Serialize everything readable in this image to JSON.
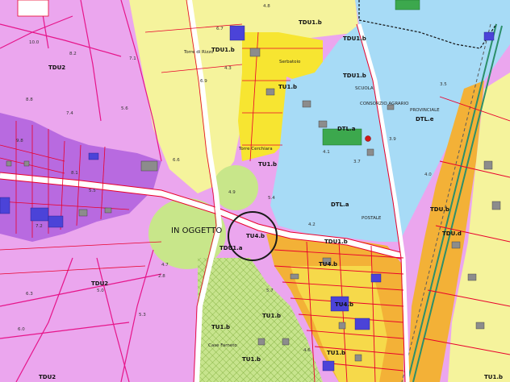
{
  "map": {
    "subject_label": "IN OGGETTO",
    "zone_labels": [
      {
        "key": "tdu2_a",
        "text": "TDU2"
      },
      {
        "key": "tdu2_b",
        "text": "TDU2"
      },
      {
        "key": "tdu2_c",
        "text": "TDU2"
      },
      {
        "key": "tdu1b_a",
        "text": "TDU1.b"
      },
      {
        "key": "tdu1b_b",
        "text": "TDU1.b"
      },
      {
        "key": "tdu1b_c",
        "text": "TDU1.b"
      },
      {
        "key": "tdu1b_d",
        "text": "TDU1.b"
      },
      {
        "key": "tdu1b_e",
        "text": "TDU1.b"
      },
      {
        "key": "tdu1a",
        "text": "TDU1.a"
      },
      {
        "key": "tu1b_a",
        "text": "TU1.b"
      },
      {
        "key": "tu1b_b",
        "text": "TU1.b"
      },
      {
        "key": "tu1b_c",
        "text": "TU1.b"
      },
      {
        "key": "tu1b_d",
        "text": "TU1.b"
      },
      {
        "key": "tu1b_e",
        "text": "TU1.b"
      },
      {
        "key": "tu1b_f",
        "text": "TU1.b"
      },
      {
        "key": "tu1b_g",
        "text": "TU1.b"
      },
      {
        "key": "tu4b_a",
        "text": "TU4.b"
      },
      {
        "key": "tu4b_b",
        "text": "TU4.b"
      },
      {
        "key": "tu4b_c",
        "text": "TU4.b"
      },
      {
        "key": "dtla_a",
        "text": "DTL.a"
      },
      {
        "key": "dtla_b",
        "text": "DTL.a"
      },
      {
        "key": "dtle",
        "text": "DTL.e"
      },
      {
        "key": "tdub",
        "text": "TDU.b"
      },
      {
        "key": "tdud",
        "text": "TDU.d"
      }
    ],
    "place_labels": [
      {
        "key": "rizzo",
        "text": "Torre di Rizzo"
      },
      {
        "key": "serbatoio",
        "text": "Serbatoio"
      },
      {
        "key": "scuola",
        "text": "SCUOLA"
      },
      {
        "key": "consorzio",
        "text": "CONSORZIO AGRARIO"
      },
      {
        "key": "provinciale",
        "text": "PROVINCIALE"
      },
      {
        "key": "cerchiara",
        "text": "Torre Cerchiara"
      },
      {
        "key": "postale",
        "text": "POSTALE"
      },
      {
        "key": "farneto",
        "text": "Case Farneto"
      }
    ],
    "elevations": [
      "10.0",
      "8.2",
      "7.1",
      "8.8",
      "7.4",
      "5.6",
      "9.8",
      "8.1",
      "6.6",
      "5.5",
      "7.2",
      "4.7",
      "5.0",
      "5.3",
      "4.3",
      "6.0",
      "5.7",
      "4.9",
      "4.2",
      "6.9",
      "4.8",
      "3.5",
      "4.0",
      "3.7",
      "3.9",
      "4.6",
      "5.4",
      "4.1",
      "6.7",
      "6.3",
      "2.8"
    ],
    "colors": {
      "tdu2": "#e9a6ec",
      "tdu1": "#f2f09a",
      "tu1": "#f5e740",
      "dtl": "#a9dcf7",
      "tu4": "#f3b339",
      "greenfield": "#c9e88a",
      "hatch_green": "#bde38a",
      "purple_zone": "#b46ade",
      "road": "#ffffff",
      "boundary": "#e8002c",
      "building_grey": "#8c8c8c",
      "building_blue": "#4b43d8",
      "building_red": "#d05050"
    }
  }
}
